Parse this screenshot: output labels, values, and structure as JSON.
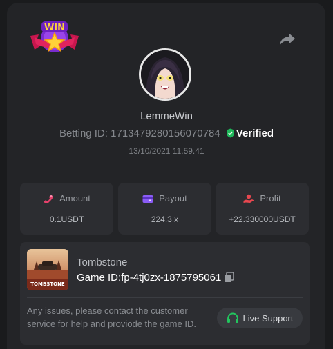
{
  "brand": {
    "logo_text": "WIN"
  },
  "profile": {
    "username": "LemmeWin",
    "betting_id_label": "Betting ID:",
    "betting_id": "1713479280156070784",
    "verified_label": "Verified",
    "datetime": "13/10/2021 11.59.41"
  },
  "stats": {
    "amount": {
      "label": "Amount",
      "value": "0.1USDT"
    },
    "payout": {
      "label": "Payout",
      "value": "224.3 x"
    },
    "profit": {
      "label": "Profit",
      "value": "+22.330000USDT"
    }
  },
  "game": {
    "title": "Tombstone",
    "thumb_text": "TOMBSTONE",
    "id_label": "Game ID:",
    "id_value": "fp-4tj0zx-1875795061",
    "issue_text": "Any issues, please contact the customer service for help and proviode the game ID.",
    "support_label": "Live Support"
  },
  "colors": {
    "panel_bg": "#232427",
    "card_bg": "#2c2d31",
    "verified_green": "#1fb85a",
    "amount_icon": "#e5416b",
    "payout_icon": "#8b5cf6",
    "profit_icon": "#e8474f",
    "support_icon": "#22c55e"
  }
}
